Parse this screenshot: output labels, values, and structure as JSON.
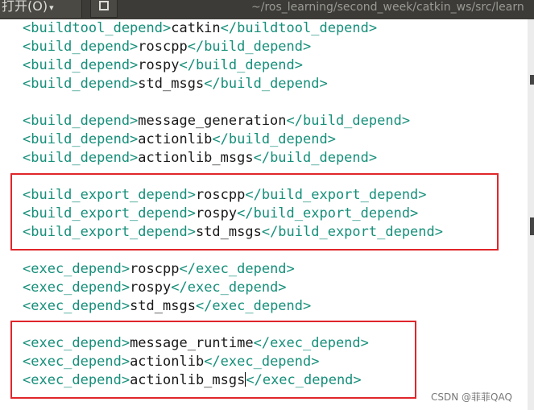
{
  "toolbar": {
    "open_label": "打开(O)",
    "path": "~/ros_learning/second_week/catkin_ws/src/learn"
  },
  "lines": [
    {
      "open": "<buildtool_depend>",
      "value": "catkin",
      "close": "</buildtool_depend>"
    },
    {
      "open": "<build_depend>",
      "value": "roscpp",
      "close": "</build_depend>"
    },
    {
      "open": "<build_depend>",
      "value": "rospy",
      "close": "</build_depend>"
    },
    {
      "open": "<build_depend>",
      "value": "std_msgs",
      "close": "</build_depend>"
    },
    {
      "open": "<build_depend>",
      "value": "message_generation",
      "close": "</build_depend>"
    },
    {
      "open": "<build_depend>",
      "value": "actionlib",
      "close": "</build_depend>"
    },
    {
      "open": "<build_depend>",
      "value": "actionlib_msgs",
      "close": "</build_depend>"
    },
    {
      "open": "<build_export_depend>",
      "value": "roscpp",
      "close": "</build_export_depend>"
    },
    {
      "open": "<build_export_depend>",
      "value": "rospy",
      "close": "</build_export_depend>"
    },
    {
      "open": "<build_export_depend>",
      "value": "std_msgs",
      "close": "</build_export_depend>"
    },
    {
      "open": "<exec_depend>",
      "value": "roscpp",
      "close": "</exec_depend>"
    },
    {
      "open": "<exec_depend>",
      "value": "rospy",
      "close": "</exec_depend>"
    },
    {
      "open": "<exec_depend>",
      "value": "std_msgs",
      "close": "</exec_depend>"
    },
    {
      "open": "<exec_depend>",
      "value": "message_runtime",
      "close": "</exec_depend>"
    },
    {
      "open": "<exec_depend>",
      "value": "actionlib",
      "close": "</exec_depend>"
    },
    {
      "open": "<exec_depend>",
      "value": "actionlib_msgs",
      "close": "</exec_depend>"
    }
  ],
  "watermark": "CSDN @菲菲QAQ",
  "colors": {
    "tag": "#168f7a",
    "text": "#1a1a1a",
    "highlight_box": "#e0262b"
  }
}
